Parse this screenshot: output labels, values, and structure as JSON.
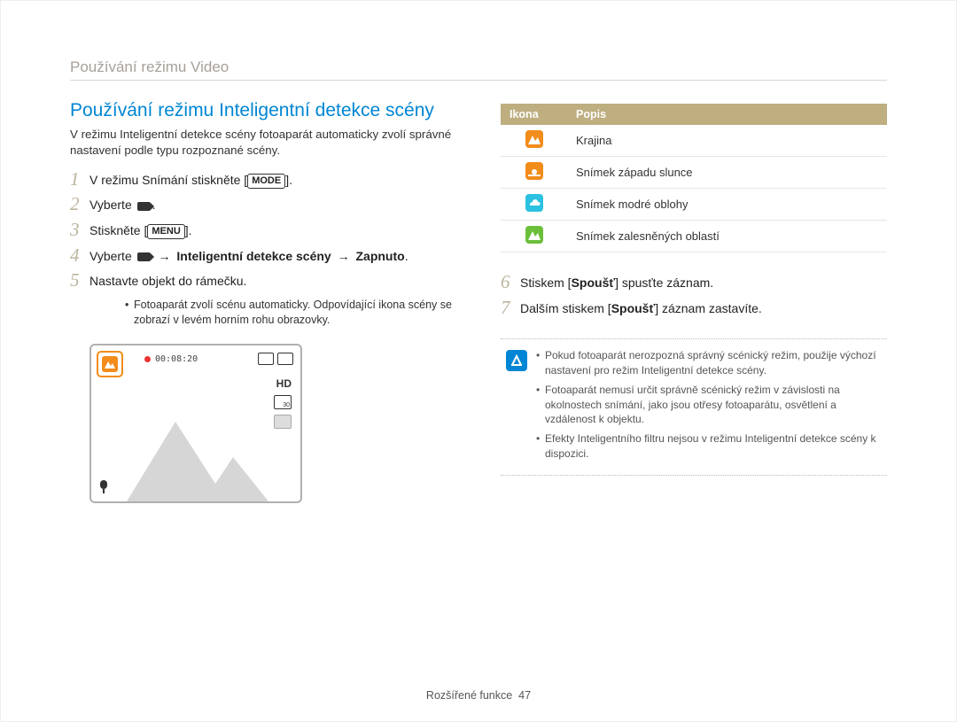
{
  "header": {
    "section_title": "Používání režimu Video"
  },
  "h2": "Používání režimu Inteligentní detekce scény",
  "intro": "V režimu Inteligentní detekce scény fotoaparát automaticky zvolí správné nastavení podle typu rozpoznané scény.",
  "steps": {
    "s1_pre": "V režimu Snímání stiskněte [",
    "s1_key": "MODE",
    "s1_post": "].",
    "s2_pre": "Vyberte ",
    "s2_post": ".",
    "s3_pre": "Stiskněte [",
    "s3_key": "MENU",
    "s3_post": "].",
    "s4_pre": "Vyberte ",
    "s4_path": "Inteligentní detekce scény",
    "s4_arrow": "→",
    "s4_on": "Zapnuto",
    "s4_end": ".",
    "s5": "Nastavte objekt do rámečku.",
    "s5_sub": "Fotoaparát zvolí scénu automaticky. Odpovídající ikona scény se zobrazí v levém horním rohu obrazovky.",
    "s6_pre": "Stiskem [",
    "s6_key": "Spoušť",
    "s6_post": "] spusťte záznam.",
    "s7_pre": "Dalším stiskem [",
    "s7_key": "Spoušť",
    "s7_post": "] záznam zastavíte.",
    "hd_label": "HD",
    "rec_time": "00:08:20"
  },
  "table": {
    "h_icon": "Ikona",
    "h_desc": "Popis",
    "rows": [
      {
        "color": "sq-orange",
        "desc": "Krajina"
      },
      {
        "color": "sq-orange2",
        "desc": "Snímek západu slunce"
      },
      {
        "color": "sq-cyan",
        "desc": "Snímek modré oblohy"
      },
      {
        "color": "sq-green",
        "desc": "Snímek zalesněných oblastí"
      }
    ]
  },
  "notes": [
    "Pokud fotoaparát nerozpozná správný scénický režim, použije výchozí nastavení pro režim Inteligentní detekce scény.",
    "Fotoaparát nemusí určit správně scénický režim v závislosti na okolnostech snímání, jako jsou otřesy fotoaparátu, osvětlení a vzdálenost k objektu.",
    "Efekty Inteligentního filtru nejsou v režimu Inteligentní detekce scény k dispozici."
  ],
  "footer": {
    "section": "Rozšířené funkce",
    "page": "47"
  }
}
